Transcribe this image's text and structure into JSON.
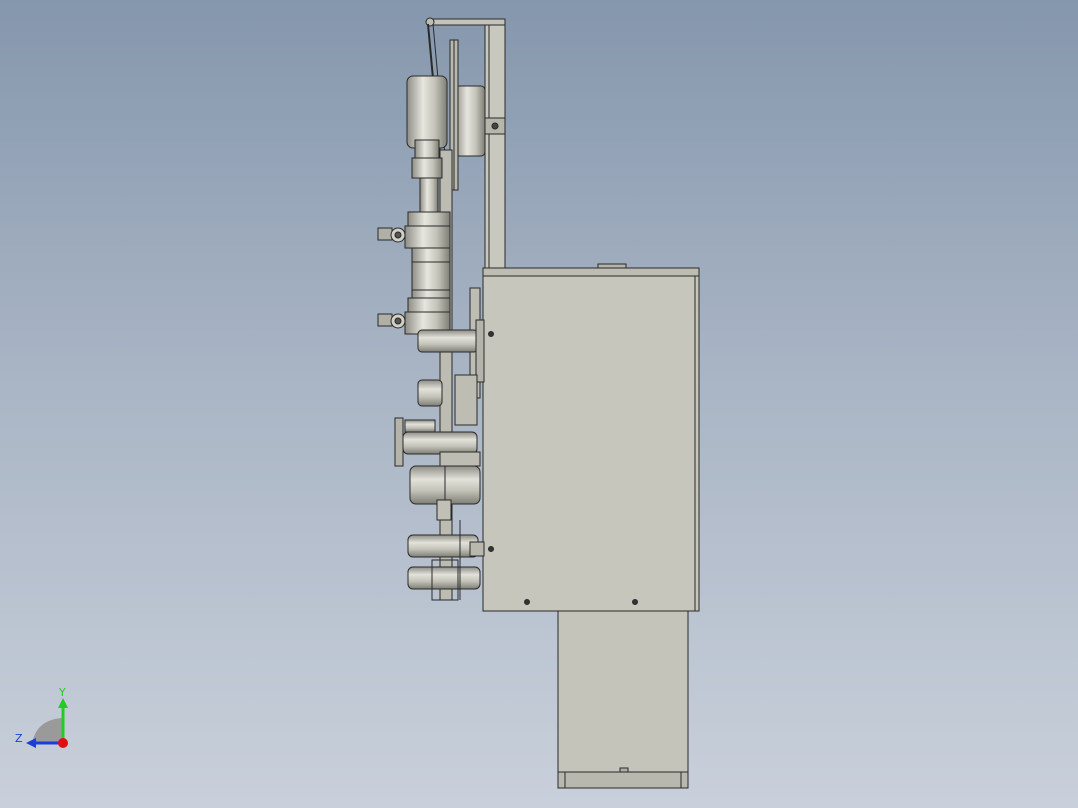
{
  "viewport": {
    "background_top": "#8597ad",
    "background_bottom": "#c9d0db"
  },
  "model": {
    "part_fill": "#c6c6bc",
    "part_shade": "#a9a99f",
    "edge_color": "#2a2a2a"
  },
  "triad": {
    "y_label": "Y",
    "z_label": "Z",
    "y_color": "#22cc22",
    "z_color": "#1a3fd8",
    "x_color": "#e01010"
  }
}
